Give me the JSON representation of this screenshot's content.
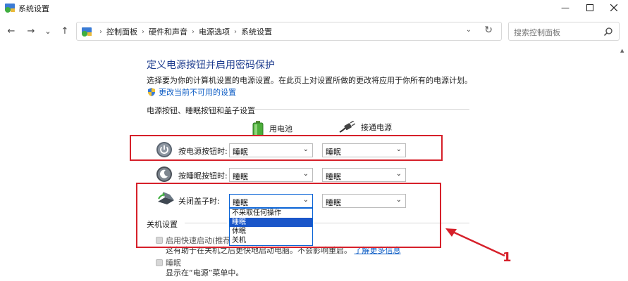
{
  "window": {
    "title": "系统设置"
  },
  "nav": {
    "back": "←",
    "forward": "→",
    "history": "⌄",
    "up": "↑",
    "breadcrumbs": [
      "控制面板",
      "硬件和声音",
      "电源选项",
      "系统设置"
    ],
    "search_placeholder": "搜索控制面板"
  },
  "page": {
    "heading": "定义电源按钮并启用密码保护",
    "description": "选择要为你的计算机设置的电源设置。在此页上对设置所做的更改将应用于你所有的电源计划。",
    "change_link": "更改当前不可用的设置",
    "section1_title": "电源按钮、睡眠按钮和盖子设置",
    "col_battery": "用电池",
    "col_plugged": "接通电源",
    "rows": [
      {
        "label": "按电源按钮时:",
        "battery": "睡眠",
        "plugged": "睡眠"
      },
      {
        "label": "按睡眠按钮时:",
        "battery": "睡眠",
        "plugged": "睡眠"
      },
      {
        "label": "关闭盖子时:",
        "battery": "睡眠",
        "plugged": "睡眠"
      }
    ],
    "dropdown_options": [
      "不采取任何操作",
      "睡眠",
      "休眠",
      "关机"
    ],
    "dropdown_selected_index": 1,
    "section2_title": "关机设置",
    "fast_startup_label": "启用快速启动(推荐)",
    "fast_startup_desc": "这有助于在关机之后更快地启动电脑。不会影响重启。",
    "learn_more_link": "了解更多信息",
    "sleep_label": "睡眠",
    "sleep_desc": "显示在“电源”菜单中。"
  },
  "annotation": {
    "number": "1",
    "color": "#d6202a"
  },
  "colors": {
    "accent": "#1a56c9",
    "heading": "#1e3d8f",
    "link": "#0b5bc4"
  }
}
